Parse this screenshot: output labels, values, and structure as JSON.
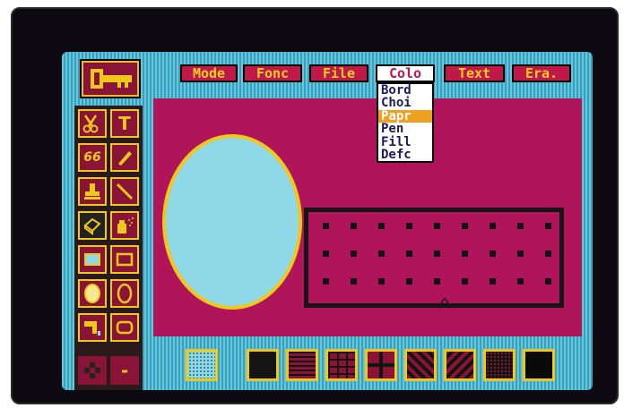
{
  "menu": [
    {
      "label": "Mode"
    },
    {
      "label": "Fonc"
    },
    {
      "label": "File"
    },
    {
      "label": "Colo",
      "active": true
    },
    {
      "label": "Text"
    },
    {
      "label": "Era."
    }
  ],
  "colour_menu": {
    "items": [
      "Bord",
      "Choi",
      "Papr",
      "Pen",
      "Fill",
      "Defc"
    ],
    "selected": "Papr"
  },
  "tools": [
    {
      "name": "scissors-icon"
    },
    {
      "name": "text-tool",
      "glyph": "T"
    },
    {
      "name": "glasses-icon",
      "glyph": "66"
    },
    {
      "name": "pencil-icon"
    },
    {
      "name": "stamp-icon"
    },
    {
      "name": "line-tool-icon"
    },
    {
      "name": "eraser-icon"
    },
    {
      "name": "spray-can-icon"
    },
    {
      "name": "filled-rectangle-icon"
    },
    {
      "name": "rectangle-outline-icon"
    },
    {
      "name": "filled-ellipse-icon"
    },
    {
      "name": "ellipse-outline-icon"
    },
    {
      "name": "paint-bucket-icon"
    },
    {
      "name": "rounded-rectangle-icon"
    },
    {
      "name": "brush-size-icon"
    },
    {
      "name": "minus-icon",
      "glyph": "-"
    }
  ],
  "patterns": [
    "light-dots",
    "solid",
    "horizontal-lines",
    "bricks",
    "weave",
    "diagonal",
    "diagonal-alt",
    "checker",
    "solid-black"
  ],
  "colors": {
    "screen": "#3fb6cf",
    "canvas": "#b0155c",
    "menu": "#c01848",
    "menu_text": "#f4d020",
    "highlight": "#f0a020",
    "ellipse_fill": "#8fd8e8"
  }
}
